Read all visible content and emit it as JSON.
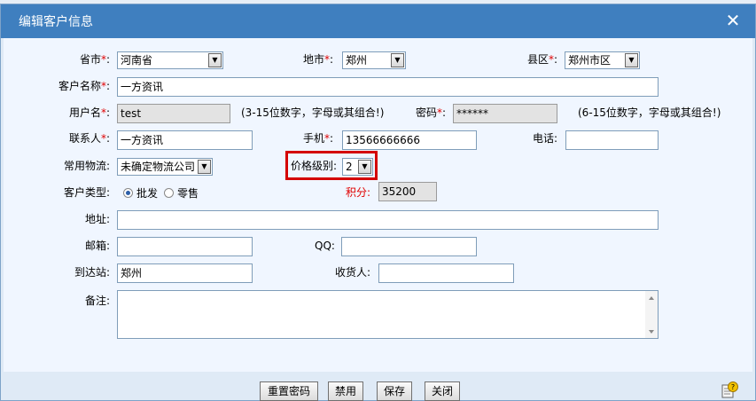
{
  "window": {
    "title": "编辑客户信息",
    "close_symbol": "✕"
  },
  "form": {
    "province": {
      "label": "省市",
      "value": "河南省"
    },
    "city": {
      "label": "地市",
      "value": "郑州"
    },
    "district": {
      "label": "县区",
      "value": "郑州市区"
    },
    "customer_name": {
      "label": "客户名称",
      "value": "一方资讯"
    },
    "username": {
      "label": "用户名",
      "value": "test",
      "hint": "(3-15位数字，字母或其组合!)"
    },
    "password": {
      "label": "密码",
      "value": "******",
      "hint": "(6-15位数字，字母或其组合!)"
    },
    "contact": {
      "label": "联系人",
      "value": "一方资讯"
    },
    "mobile": {
      "label": "手机",
      "value": "13566666666"
    },
    "phone": {
      "label": "电话",
      "value": ""
    },
    "logistics": {
      "label": "常用物流:",
      "value": "未确定物流公司"
    },
    "price_level": {
      "label": "价格级别:",
      "value": "2"
    },
    "customer_type": {
      "label": "客户类型:",
      "options": [
        "批发",
        "零售"
      ],
      "selected": "批发"
    },
    "points": {
      "label": "积分:",
      "value": "35200"
    },
    "address": {
      "label": "地址:",
      "value": ""
    },
    "email": {
      "label": "邮箱:",
      "value": ""
    },
    "qq": {
      "label": "QQ:",
      "value": ""
    },
    "station": {
      "label": "到达站:",
      "value": "郑州"
    },
    "receiver": {
      "label": "收货人:",
      "value": ""
    },
    "remark": {
      "label": "备注:",
      "value": ""
    }
  },
  "buttons": {
    "reset_password": "重置密码",
    "disable": "禁用",
    "save": "保存",
    "close": "关闭"
  },
  "colors": {
    "title_bar": "#3f7fbf",
    "required": "#e00000",
    "highlight": "#d40000"
  },
  "icons": {
    "help": "help-icon"
  }
}
